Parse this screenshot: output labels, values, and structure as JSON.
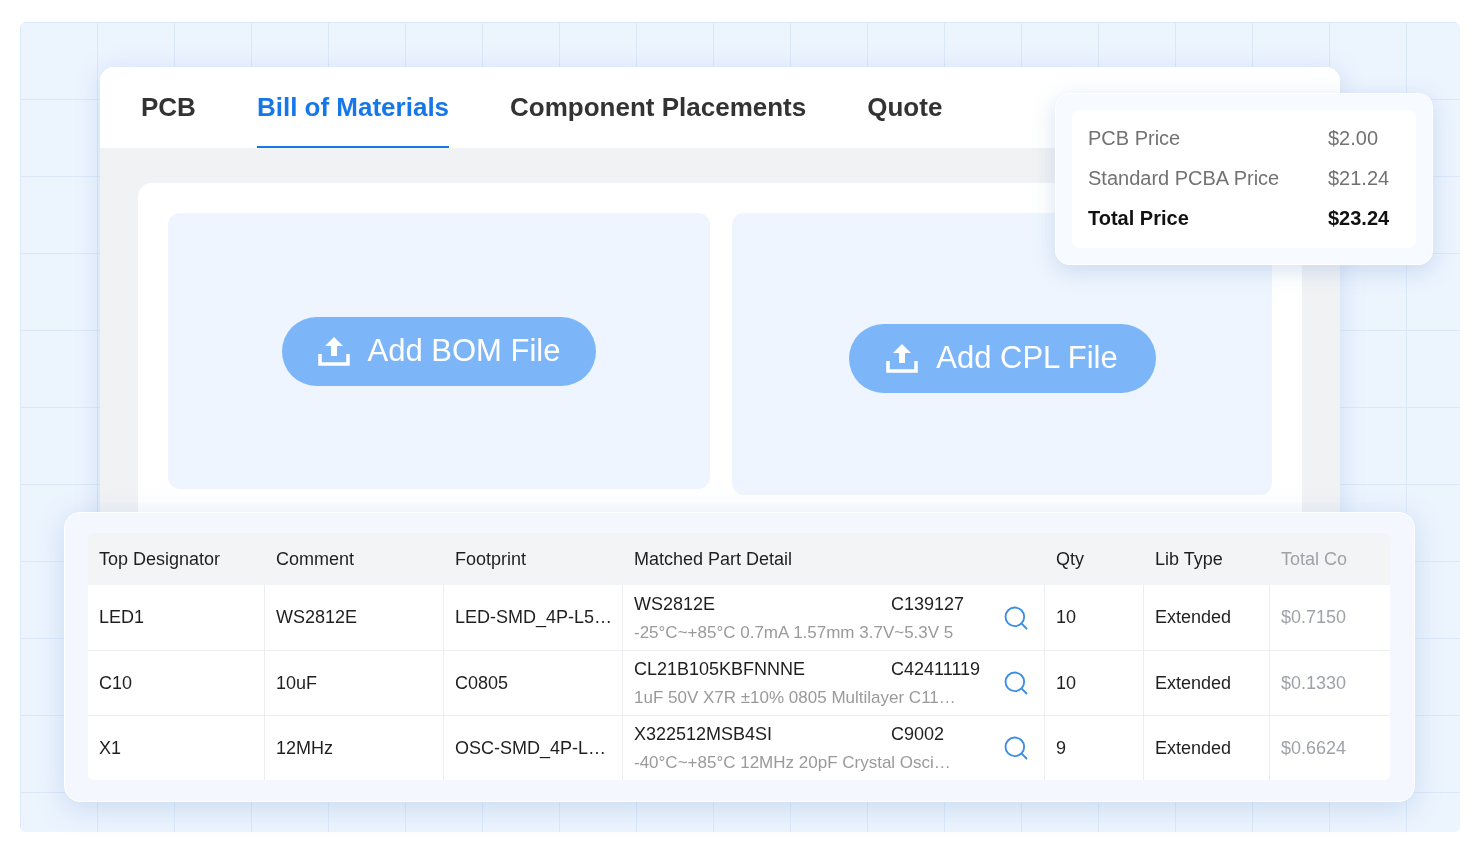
{
  "tabs": [
    {
      "label": "PCB",
      "selected": false
    },
    {
      "label": "Bill of Materials",
      "selected": true
    },
    {
      "label": "Component Placements",
      "selected": false
    },
    {
      "label": "Quote",
      "selected": false
    }
  ],
  "upload_panels": [
    {
      "button": "Add BOM File"
    },
    {
      "button": "Add CPL File"
    }
  ],
  "price_summary": {
    "rows": [
      {
        "kind": "item",
        "label": "PCB Price",
        "value": "$2.00"
      },
      {
        "kind": "item",
        "label": "Standard PCBA Price",
        "value": "$21.24"
      },
      {
        "kind": "total",
        "label": "Total Price",
        "value": "$23.24"
      }
    ]
  },
  "bom_table": {
    "columns": [
      "Top Designator",
      "Comment",
      "Footprint",
      "Matched Part Detail",
      "Qty",
      "Lib Type",
      "Total Co"
    ],
    "rows": [
      {
        "top_designator": "LED1",
        "comment": "WS2812E",
        "footprint": "LED-SMD_4P-L5…",
        "part_number": "WS2812E",
        "part_code": "C139127",
        "part_description": "-25°C~+85°C 0.7mA 1.57mm 3.7V~5.3V 5",
        "qty": "10",
        "lib_type": "Extended",
        "column_7": "$0.7150"
      },
      {
        "top_designator": "C10",
        "comment": "10uF",
        "footprint": "C0805",
        "part_number": "CL21B105KBFNNNE",
        "part_code": "C42411119",
        "part_description": "1uF 50V X7R ±10% 0805 Multilayer C11…",
        "qty": "10",
        "lib_type": "Extended",
        "column_7": "$0.1330"
      },
      {
        "top_designator": "X1",
        "comment": "12MHz",
        "footprint": "OSC-SMD_4P-L…",
        "part_number": "X322512MSB4SI",
        "part_code": "C9002",
        "part_description": "-40°C~+85°C 12MHz 20pF Crystal Osci…",
        "qty": "9",
        "lib_type": "Extended",
        "column_7": "$0.6624"
      }
    ]
  }
}
